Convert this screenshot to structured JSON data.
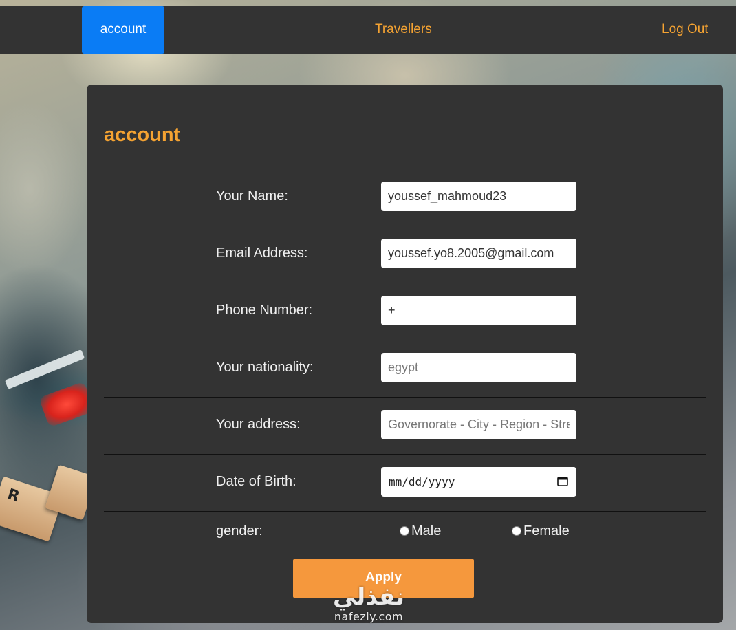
{
  "nav": {
    "account": "account",
    "travellers": "Travellers",
    "logout": "Log Out"
  },
  "panel": {
    "title": "account"
  },
  "form": {
    "name": {
      "label": "Your Name:",
      "value": "youssef_mahmoud23",
      "placeholder": ""
    },
    "email": {
      "label": "Email Address:",
      "value": "youssef.yo8.2005@gmail.com",
      "placeholder": ""
    },
    "phone": {
      "label": "Phone Number:",
      "value": "+",
      "placeholder": ""
    },
    "nationality": {
      "label": "Your nationality:",
      "value": "",
      "placeholder": "egypt"
    },
    "address": {
      "label": "Your address:",
      "value": "",
      "placeholder": "Governorate - City - Region - Street"
    },
    "dob": {
      "label": "Date of Birth:",
      "value": "mm/dd/yyyy"
    },
    "gender": {
      "label": "gender:",
      "options": [
        "Male",
        "Female"
      ]
    },
    "apply_label": "Apply"
  },
  "watermark": {
    "arabic": "نفذلي",
    "latin": "nafezly.com"
  },
  "colors": {
    "accent_orange": "#f5a332",
    "button_orange": "#f5983d",
    "active_blue": "#0a7cf5",
    "panel_bg": "#333333"
  }
}
